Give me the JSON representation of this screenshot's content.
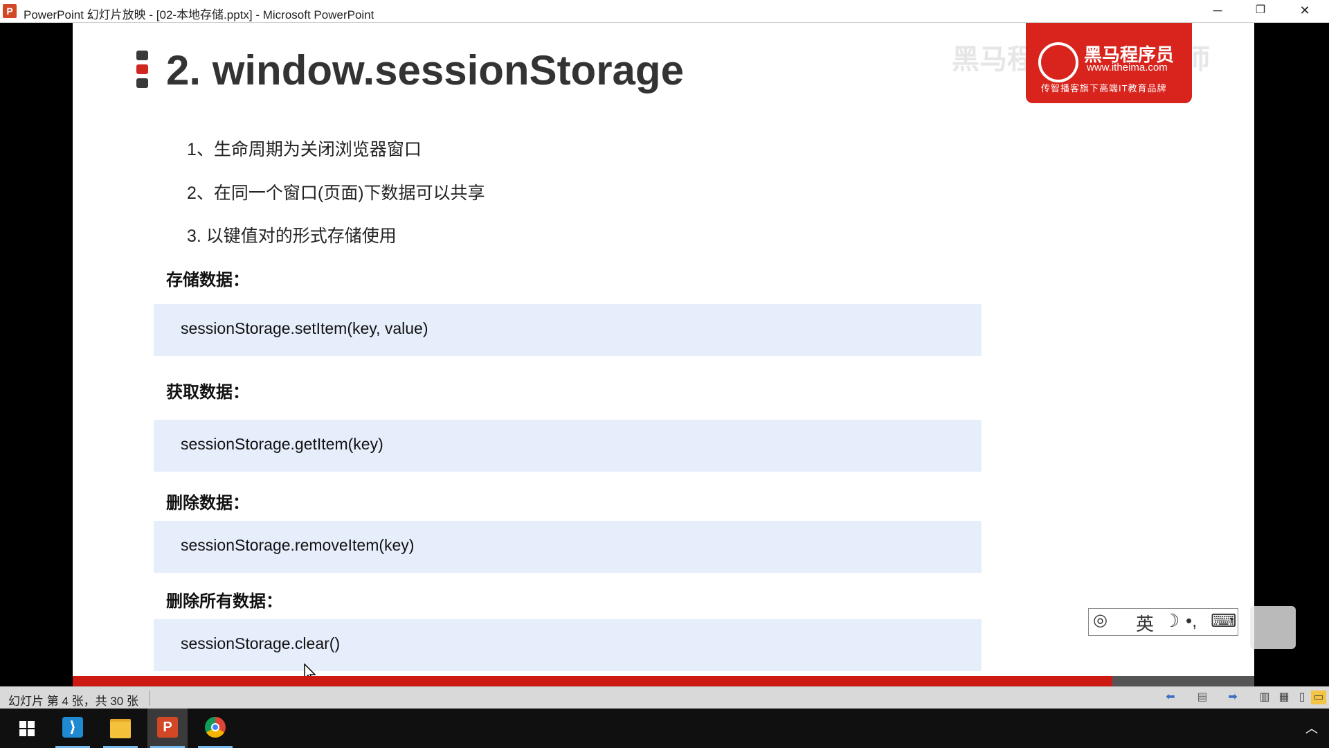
{
  "window": {
    "title": "PowerPoint 幻灯片放映 - [02-本地存储.pptx] - Microsoft PowerPoint",
    "app_icon_letter": "P",
    "minimize": "─",
    "restore": "❐",
    "close": "✕"
  },
  "slide": {
    "title": "2. window.sessionStorage",
    "points": [
      "1、生命周期为关闭浏览器窗口",
      "2、在同一个窗口(页面)下数据可以共享",
      "3.  以键值对的形式存储使用"
    ],
    "sections": [
      {
        "label": "存储数据：",
        "code": "sessionStorage.setItem(key, value)"
      },
      {
        "label": "获取数据：",
        "code": "sessionStorage.getItem(key)"
      },
      {
        "label": "删除数据：",
        "code": "sessionStorage.removeItem(key)"
      },
      {
        "label": "删除所有数据：",
        "code": "sessionStorage.clear()"
      }
    ],
    "logo": {
      "brand": "黑马程序员",
      "url": "www.itheima.com",
      "slogan": "传智播客旗下高端IT教育品牌"
    },
    "watermark": "黑马程序员 pink老师",
    "progress_fraction": 0.88
  },
  "ime_toolbar": {
    "items": [
      "英",
      "☽",
      "•,",
      "⌨"
    ]
  },
  "statusbar": {
    "slide_info": "幻灯片 第 4 张，共 30 张"
  },
  "colors": {
    "accent_red": "#cc1a12",
    "code_bg": "#e6eefb"
  }
}
